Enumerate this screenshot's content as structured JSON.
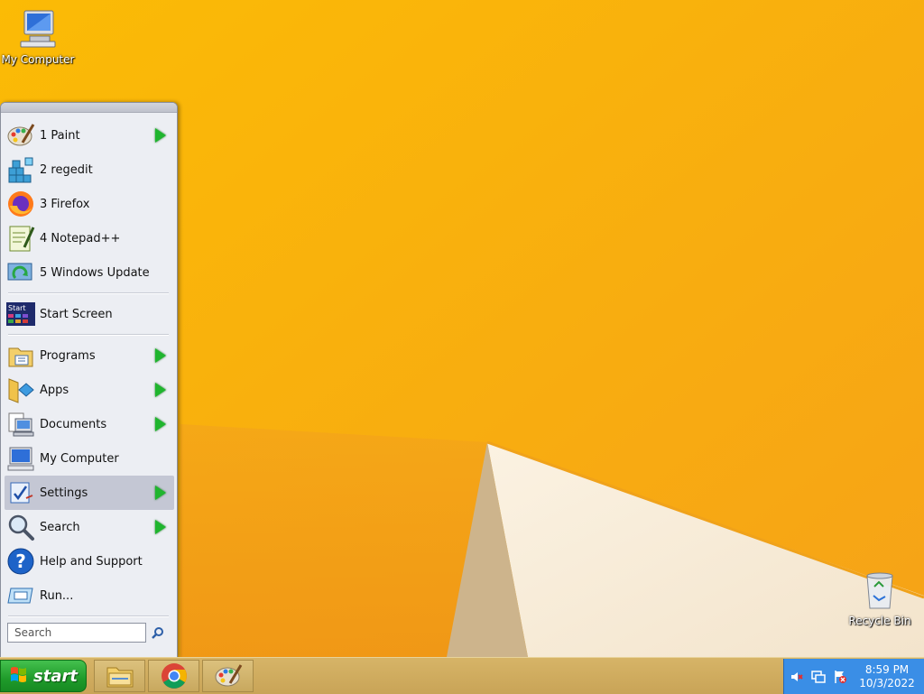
{
  "desktop": {
    "icons": [
      {
        "label": "My Computer",
        "icon": "my-computer-icon"
      },
      {
        "label": "Recycle Bin",
        "icon": "recycle-bin-icon"
      }
    ]
  },
  "start_menu": {
    "recent": [
      {
        "label": "1 Paint",
        "icon": "paint-icon",
        "has_submenu": true
      },
      {
        "label": "2 regedit",
        "icon": "regedit-icon",
        "has_submenu": false
      },
      {
        "label": "3 Firefox",
        "icon": "firefox-icon",
        "has_submenu": false
      },
      {
        "label": "4 Notepad++",
        "icon": "notepad-plus-plus-icon",
        "has_submenu": false
      },
      {
        "label": "5 Windows Update",
        "icon": "windows-update-icon",
        "has_submenu": false
      }
    ],
    "start_screen": {
      "label": "Start Screen",
      "icon": "start-screen-icon",
      "icon_text": "Start"
    },
    "main": [
      {
        "label": "Programs",
        "icon": "programs-icon",
        "has_submenu": true
      },
      {
        "label": "Apps",
        "icon": "apps-icon",
        "has_submenu": true
      },
      {
        "label": "Documents",
        "icon": "documents-icon",
        "has_submenu": true
      },
      {
        "label": "My Computer",
        "icon": "my-computer-icon",
        "has_submenu": false
      },
      {
        "label": "Settings",
        "icon": "settings-icon",
        "has_submenu": true,
        "highlighted": true
      },
      {
        "label": "Search",
        "icon": "search-icon",
        "has_submenu": true
      },
      {
        "label": "Help and Support",
        "icon": "help-icon",
        "has_submenu": false
      },
      {
        "label": "Run...",
        "icon": "run-icon",
        "has_submenu": false
      }
    ],
    "search": {
      "placeholder": "Search"
    }
  },
  "taskbar": {
    "start_label": "start",
    "pinned": [
      {
        "name": "file-explorer",
        "icon": "folder-icon"
      },
      {
        "name": "chrome",
        "icon": "chrome-icon"
      },
      {
        "name": "paint",
        "icon": "paint-icon"
      }
    ],
    "tray": {
      "icons": [
        "volume-muted-icon",
        "network-icon",
        "action-center-alert-icon"
      ],
      "time": "8:59 PM",
      "date": "10/3/2022"
    }
  },
  "colors": {
    "accent_green": "#1fb52e",
    "tray_blue": "#3a8ee6",
    "wallpaper": "#f8b400"
  }
}
